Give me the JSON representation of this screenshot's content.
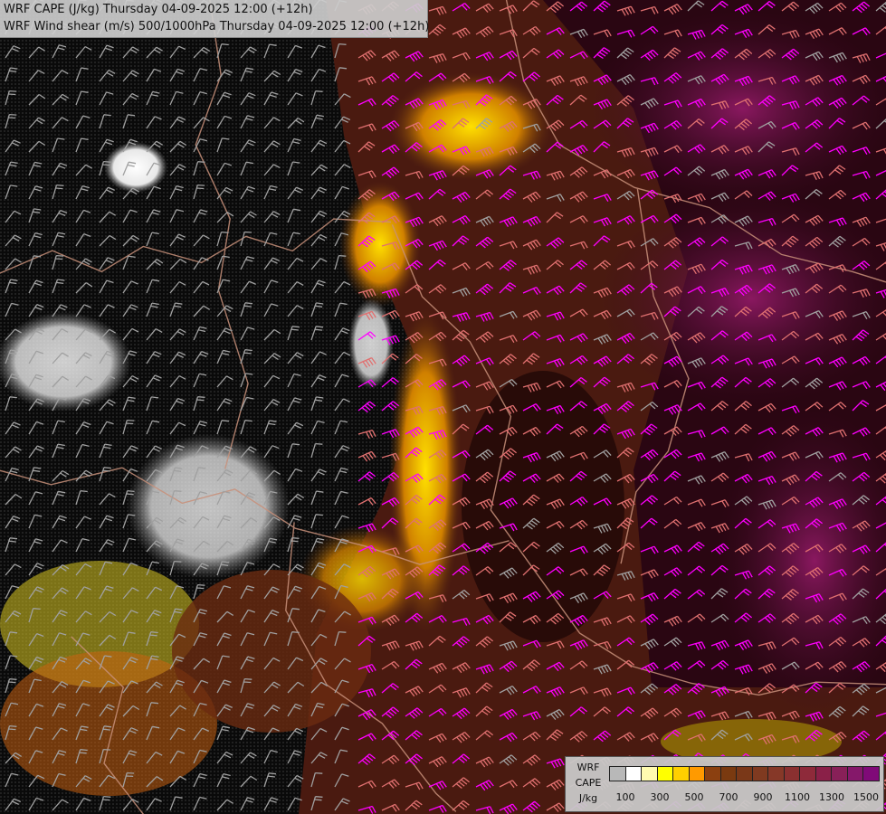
{
  "title": {
    "line1": "WRF CAPE (J/kg) Thursday 04-09-2025 12:00 (+12h)",
    "line2": "WRF Wind shear (m/s) 500/1000hPa Thursday 04-09-2025 12:00 (+12h)"
  },
  "legend": {
    "label_top": "WRF",
    "label_mid": "CAPE",
    "label_unit": "J/kg",
    "colors": [
      "#b8b8b8",
      "#ffffff",
      "#fffbb0",
      "#ffff00",
      "#ffd000",
      "#ff9a00",
      "#8b4010",
      "#7a3a10",
      "#7a3818",
      "#7f3a20",
      "#863828",
      "#8a3030",
      "#8e2a3a",
      "#8a2048",
      "#882058",
      "#85186a",
      "#800a78"
    ],
    "ticks": [
      "100",
      "300",
      "500",
      "700",
      "900",
      "1100",
      "1300",
      "1500"
    ]
  },
  "colors": {
    "barb_low": "#a0a0a0",
    "barb_mid": "#e07070",
    "barb_high": "#ff00ff",
    "background": "#000000"
  }
}
